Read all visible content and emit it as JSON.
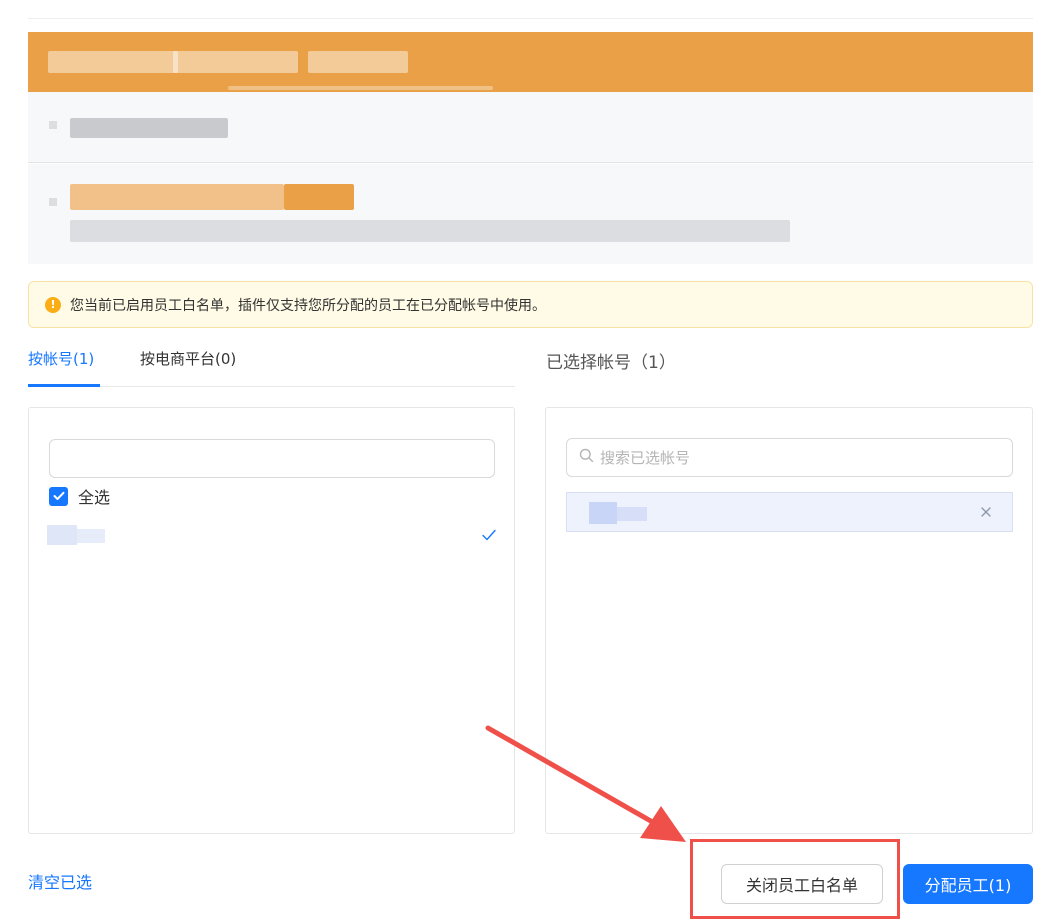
{
  "alert": {
    "text": "您当前已启用员工白名单，插件仅支持您所分配的员工在已分配帐号中使用。",
    "icon": "warning-circle-icon",
    "color": "#faad14"
  },
  "tabs": [
    {
      "label": "按帐号(1)",
      "active": true
    },
    {
      "label": "按电商平台(0)",
      "active": false
    }
  ],
  "left_panel": {
    "search_value": "",
    "select_all_label": "全选",
    "select_all_checked": true,
    "items_count": 1
  },
  "right_panel": {
    "title": "已选择帐号（1）",
    "search_placeholder": "搜索已选帐号",
    "items_count": 1
  },
  "footer": {
    "clear_label": "清空已选",
    "close_whitelist_label": "关闭员工白名单",
    "assign_label": "分配员工(1)"
  },
  "colors": {
    "accent": "#1677ff",
    "banner": "#e9a046",
    "annotation": "#f0504a"
  }
}
